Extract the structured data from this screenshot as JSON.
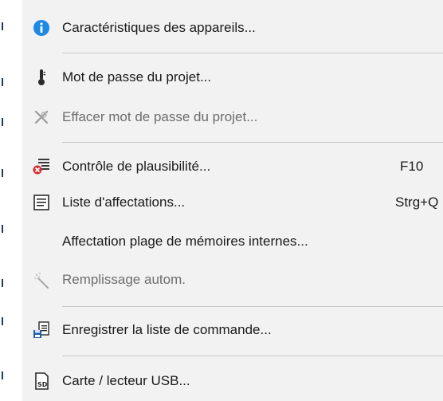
{
  "menu": {
    "items": [
      {
        "label": "Caractéristiques des appareils...",
        "icon": "info-icon",
        "enabled": true
      },
      {
        "label": "Mot de passe du projet...",
        "icon": "thermometer-icon",
        "enabled": true
      },
      {
        "label": "Effacer mot de passe du projet...",
        "icon": "erase-password-icon",
        "enabled": false
      },
      {
        "label": "Contrôle de plausibilité...",
        "shortcut": "F10",
        "icon": "plausibility-check-icon",
        "enabled": true
      },
      {
        "label": "Liste d'affectations...",
        "shortcut": "Strg+Q",
        "icon": "list-icon",
        "enabled": true
      },
      {
        "label": "Affectation plage de mémoires internes...",
        "enabled": true
      },
      {
        "label": "Remplissage autom.",
        "icon": "magic-wand-icon",
        "enabled": false
      },
      {
        "label": "Enregistrer la liste de commande...",
        "icon": "save-list-icon",
        "enabled": true
      },
      {
        "label": "Carte / lecteur USB...",
        "icon": "sd-card-icon",
        "enabled": true
      }
    ]
  },
  "colors": {
    "menu_background": "#f2f2f2",
    "info_blue": "#1e88e5",
    "disabled_text": "#6d6d6d",
    "error_red": "#d32f2f"
  }
}
